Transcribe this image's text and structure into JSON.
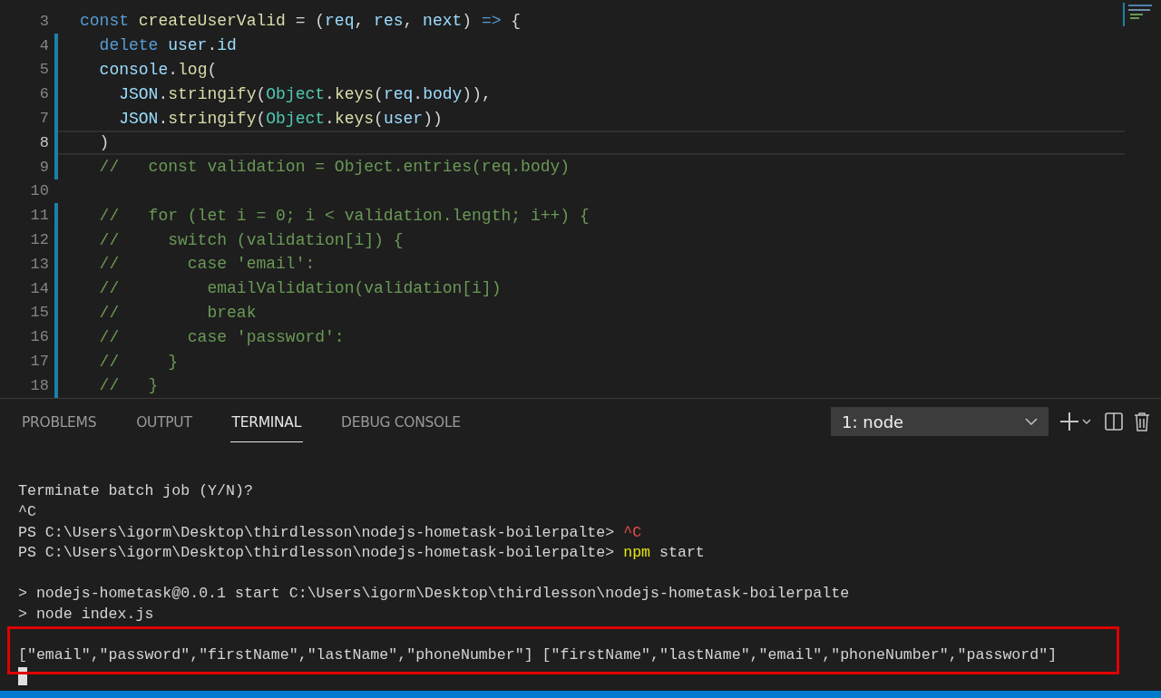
{
  "editor": {
    "lines": [
      {
        "number": "3",
        "modified": false,
        "current": false,
        "tokens": [
          {
            "text": "const ",
            "kind": "keyword"
          },
          {
            "text": "createUserValid",
            "kind": "function"
          },
          {
            "text": " = (",
            "kind": "plain"
          },
          {
            "text": "req",
            "kind": "variable"
          },
          {
            "text": ", ",
            "kind": "plain"
          },
          {
            "text": "res",
            "kind": "param"
          },
          {
            "text": ", ",
            "kind": "plain"
          },
          {
            "text": "next",
            "kind": "param"
          },
          {
            "text": ") ",
            "kind": "plain"
          },
          {
            "text": "=>",
            "kind": "keyword"
          },
          {
            "text": " {",
            "kind": "plain"
          }
        ]
      },
      {
        "number": "4",
        "modified": true,
        "current": false,
        "tokens": [
          {
            "text": "  delete ",
            "kind": "keyword"
          },
          {
            "text": "user",
            "kind": "variable"
          },
          {
            "text": ".",
            "kind": "plain"
          },
          {
            "text": "id",
            "kind": "variable"
          }
        ]
      },
      {
        "number": "5",
        "modified": true,
        "current": false,
        "tokens": [
          {
            "text": "  console",
            "kind": "variable"
          },
          {
            "text": ".",
            "kind": "plain"
          },
          {
            "text": "log",
            "kind": "function"
          },
          {
            "text": "(",
            "kind": "plain"
          }
        ]
      },
      {
        "number": "6",
        "modified": true,
        "current": false,
        "tokens": [
          {
            "text": "    JSON",
            "kind": "variable"
          },
          {
            "text": ".",
            "kind": "plain"
          },
          {
            "text": "stringify",
            "kind": "function"
          },
          {
            "text": "(",
            "kind": "plain"
          },
          {
            "text": "Object",
            "kind": "class"
          },
          {
            "text": ".",
            "kind": "plain"
          },
          {
            "text": "keys",
            "kind": "function"
          },
          {
            "text": "(",
            "kind": "plain"
          },
          {
            "text": "req",
            "kind": "variable"
          },
          {
            "text": ".",
            "kind": "plain"
          },
          {
            "text": "body",
            "kind": "variable"
          },
          {
            "text": ")),",
            "kind": "plain"
          }
        ]
      },
      {
        "number": "7",
        "modified": true,
        "current": false,
        "tokens": [
          {
            "text": "    JSON",
            "kind": "variable"
          },
          {
            "text": ".",
            "kind": "plain"
          },
          {
            "text": "stringify",
            "kind": "function"
          },
          {
            "text": "(",
            "kind": "plain"
          },
          {
            "text": "Object",
            "kind": "class"
          },
          {
            "text": ".",
            "kind": "plain"
          },
          {
            "text": "keys",
            "kind": "function"
          },
          {
            "text": "(",
            "kind": "plain"
          },
          {
            "text": "user",
            "kind": "variable"
          },
          {
            "text": "))",
            "kind": "plain"
          }
        ]
      },
      {
        "number": "8",
        "modified": true,
        "current": true,
        "tokens": [
          {
            "text": "  )",
            "kind": "plain"
          }
        ]
      },
      {
        "number": "9",
        "modified": true,
        "current": false,
        "tokens": [
          {
            "text": "  //   const validation = Object.entries(req.body)",
            "kind": "comment"
          }
        ]
      },
      {
        "number": "10",
        "modified": false,
        "current": false
      },
      {
        "number": "11",
        "modified": true,
        "current": false,
        "tokens": [
          {
            "text": "  //   for (let i = 0; i < validation.length; i++) {",
            "kind": "comment"
          }
        ]
      },
      {
        "number": "12",
        "modified": true,
        "current": false,
        "tokens": [
          {
            "text": "  //     switch (validation[i]) {",
            "kind": "comment"
          }
        ]
      },
      {
        "number": "13",
        "modified": true,
        "current": false,
        "tokens": [
          {
            "text": "  //       case 'email':",
            "kind": "comment"
          }
        ]
      },
      {
        "number": "14",
        "modified": true,
        "current": false,
        "tokens": [
          {
            "text": "  //         emailValidation(validation[i])",
            "kind": "comment"
          }
        ]
      },
      {
        "number": "15",
        "modified": true,
        "current": false,
        "tokens": [
          {
            "text": "  //         break",
            "kind": "comment"
          }
        ]
      },
      {
        "number": "16",
        "modified": true,
        "current": false,
        "tokens": [
          {
            "text": "  //       case 'password':",
            "kind": "comment"
          }
        ]
      },
      {
        "number": "17",
        "modified": true,
        "current": false,
        "tokens": [
          {
            "text": "  //     }",
            "kind": "comment"
          }
        ]
      },
      {
        "number": "18",
        "modified": true,
        "current": false,
        "tokens": [
          {
            "text": "  //   }",
            "kind": "comment"
          }
        ]
      }
    ]
  },
  "panel": {
    "tabs": [
      {
        "label": "PROBLEMS",
        "selected": false
      },
      {
        "label": "OUTPUT",
        "selected": false
      },
      {
        "label": "TERMINAL",
        "selected": true
      },
      {
        "label": "DEBUG CONSOLE",
        "selected": false
      }
    ],
    "terminal_select": {
      "value": "1: node"
    },
    "terminal": [
      {
        "kind": "blank"
      },
      {
        "kind": "text",
        "highlighted": false,
        "tokens": [
          {
            "text": "Terminate batch job (Y/N)?",
            "kind": "plain"
          }
        ]
      },
      {
        "kind": "text",
        "highlighted": false,
        "tokens": [
          {
            "text": "^C",
            "kind": "plain"
          }
        ]
      },
      {
        "kind": "text",
        "highlighted": false,
        "tokens": [
          {
            "text": "PS C:\\Users\\igorm\\Desktop\\thirdlesson\\nodejs-hometask-boilerpalte> ",
            "kind": "plain"
          },
          {
            "text": "^C",
            "kind": "error"
          }
        ]
      },
      {
        "kind": "text",
        "highlighted": false,
        "tokens": [
          {
            "text": "PS C:\\Users\\igorm\\Desktop\\thirdlesson\\nodejs-hometask-boilerpalte> ",
            "kind": "plain"
          },
          {
            "text": "npm",
            "kind": "command"
          },
          {
            "text": " start",
            "kind": "plain"
          }
        ]
      },
      {
        "kind": "blank"
      },
      {
        "kind": "text",
        "highlighted": false,
        "tokens": [
          {
            "text": "> nodejs-hometask@0.0.1 start C:\\Users\\igorm\\Desktop\\thirdlesson\\nodejs-hometask-boilerpalte",
            "kind": "plain"
          }
        ]
      },
      {
        "kind": "text",
        "highlighted": false,
        "tokens": [
          {
            "text": "> node index.js",
            "kind": "plain"
          }
        ]
      },
      {
        "kind": "blank"
      },
      {
        "kind": "text",
        "highlighted": true,
        "tokens": [
          {
            "text": "[\"email\",\"password\",\"firstName\",\"lastName\",\"phoneNumber\"] [\"firstName\",\"lastName\",\"email\",\"phoneNumber\",\"password\"]",
            "kind": "plain"
          }
        ]
      },
      {
        "kind": "cursor"
      }
    ]
  }
}
